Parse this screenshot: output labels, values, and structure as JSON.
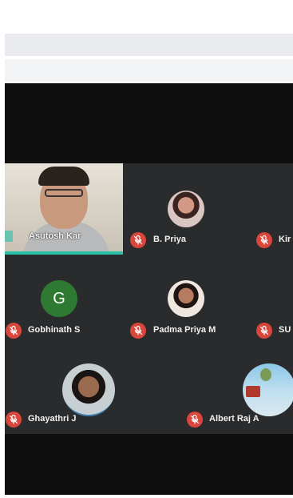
{
  "participants": [
    {
      "name": "Asutosh Kar",
      "type": "video"
    },
    {
      "name": "B. Priya",
      "type": "photo"
    },
    {
      "name": "Kir",
      "type": "clipped"
    },
    {
      "name": "Gobhinath S",
      "type": "letter",
      "initial": "G"
    },
    {
      "name": "Padma Priya M",
      "type": "photo"
    },
    {
      "name": "SU",
      "type": "clipped"
    },
    {
      "name": "Ghayathri J",
      "type": "photo"
    },
    {
      "name": "Albert Raj A",
      "type": "photo"
    }
  ],
  "colors": {
    "tile_bg": "#2a2b2d",
    "meeting_bg": "#0f0f10",
    "muted_mic": "#d9463b",
    "active_speaker": "#27c1a6",
    "letter_avatar": "#2f7a32"
  },
  "icons": {
    "muted": "mic-off-icon"
  }
}
